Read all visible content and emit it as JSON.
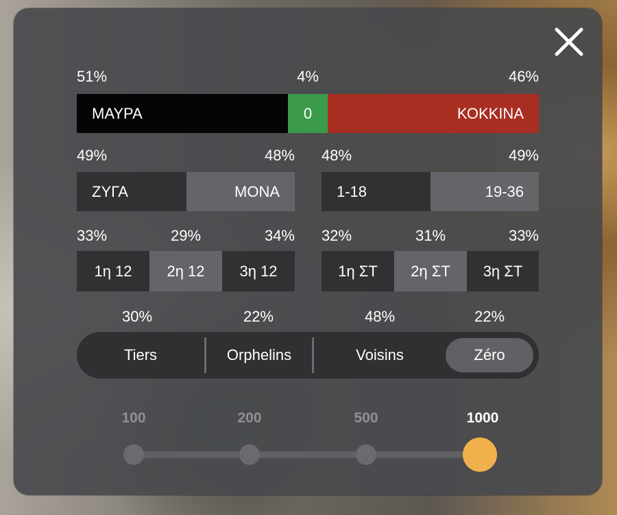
{
  "close": {
    "icon": "close-icon"
  },
  "color_row": {
    "black": {
      "pct": "51%",
      "label": "ΜΑΥΡΑ"
    },
    "zero": {
      "pct": "4%",
      "label": "0"
    },
    "red": {
      "pct": "46%",
      "label": "ΚΟΚΚΙΝΑ"
    }
  },
  "even_odd": {
    "even": {
      "pct": "49%",
      "label": "ΖΥΓΑ"
    },
    "odd": {
      "pct": "48%",
      "label": "ΜΟΝΑ"
    }
  },
  "low_high": {
    "low": {
      "pct": "48%",
      "label": "1-18"
    },
    "high": {
      "pct": "49%",
      "label": "19-36"
    }
  },
  "dozens": [
    {
      "pct": "33%",
      "label": "1η 12"
    },
    {
      "pct": "29%",
      "label": "2η 12"
    },
    {
      "pct": "34%",
      "label": "3η 12"
    }
  ],
  "columns": [
    {
      "pct": "32%",
      "label": "1η ΣΤ"
    },
    {
      "pct": "31%",
      "label": "2η ΣΤ"
    },
    {
      "pct": "33%",
      "label": "3η ΣΤ"
    }
  ],
  "racetrack": [
    {
      "pct": "30%",
      "label": "Tiers"
    },
    {
      "pct": "22%",
      "label": "Orphelins"
    },
    {
      "pct": "48%",
      "label": "Voisins"
    },
    {
      "pct": "22%",
      "label": "Zéro"
    }
  ],
  "racetrack_selected": "Zéro",
  "rounds": {
    "options": [
      "100",
      "200",
      "500",
      "1000"
    ],
    "selected": "1000"
  },
  "colors": {
    "black": "#050505",
    "green": "#3c9a4b",
    "red": "#a92e22",
    "accent": "#f0b04c"
  }
}
